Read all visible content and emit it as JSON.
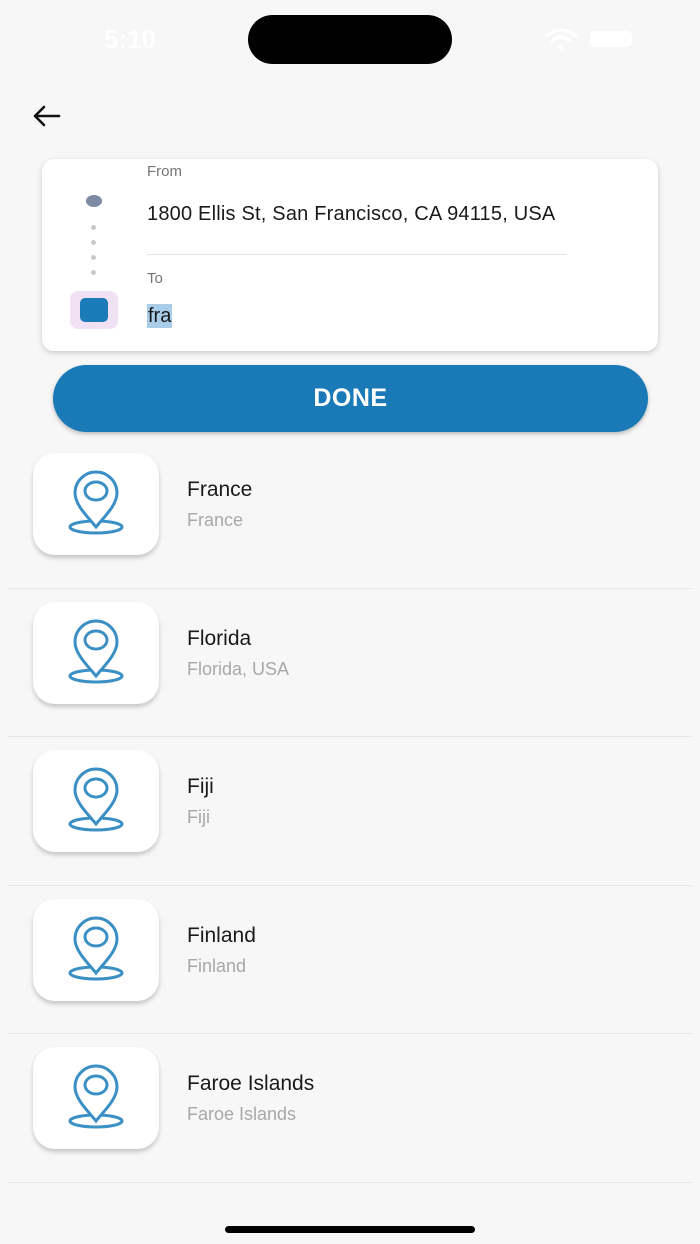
{
  "status_bar": {
    "time": "5:10"
  },
  "route": {
    "from_label": "From",
    "from_value": "1800 Ellis St, San Francisco, CA 94115, USA",
    "to_label": "To",
    "to_value": "fra"
  },
  "done_label": "DONE",
  "results": [
    {
      "title": "France",
      "subtitle": "France"
    },
    {
      "title": "Florida",
      "subtitle": "Florida, USA"
    },
    {
      "title": "Fiji",
      "subtitle": "Fiji"
    },
    {
      "title": "Finland",
      "subtitle": "Finland"
    },
    {
      "title": "Faroe Islands",
      "subtitle": "Faroe Islands"
    }
  ],
  "colors": {
    "accent": "#1a7ab8",
    "background": "#f7f7f7",
    "pin": "#3a8fc4"
  },
  "icons": [
    "back-arrow-icon",
    "location-pin-icon",
    "wifi-icon",
    "battery-icon"
  ]
}
